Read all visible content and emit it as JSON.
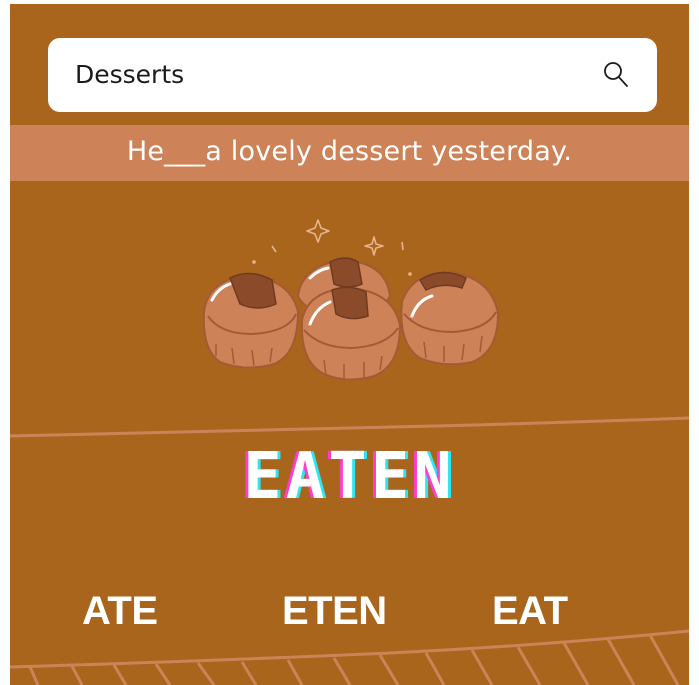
{
  "search": {
    "value": "Desserts",
    "icon": "search-icon"
  },
  "question": {
    "sentence": "He___a lovely dessert yesterday."
  },
  "illustration": {
    "icon": "cream-puffs-illustration"
  },
  "display_word": "EATEN",
  "options": [
    {
      "label": "ATE"
    },
    {
      "label": "ETEN"
    },
    {
      "label": "EAT"
    }
  ],
  "colors": {
    "background": "#a9651c",
    "banner": "#cd8258",
    "pastry": "#cd8258",
    "glitch_pink": "#ff3ccf",
    "glitch_cyan": "#2fe5f2"
  }
}
